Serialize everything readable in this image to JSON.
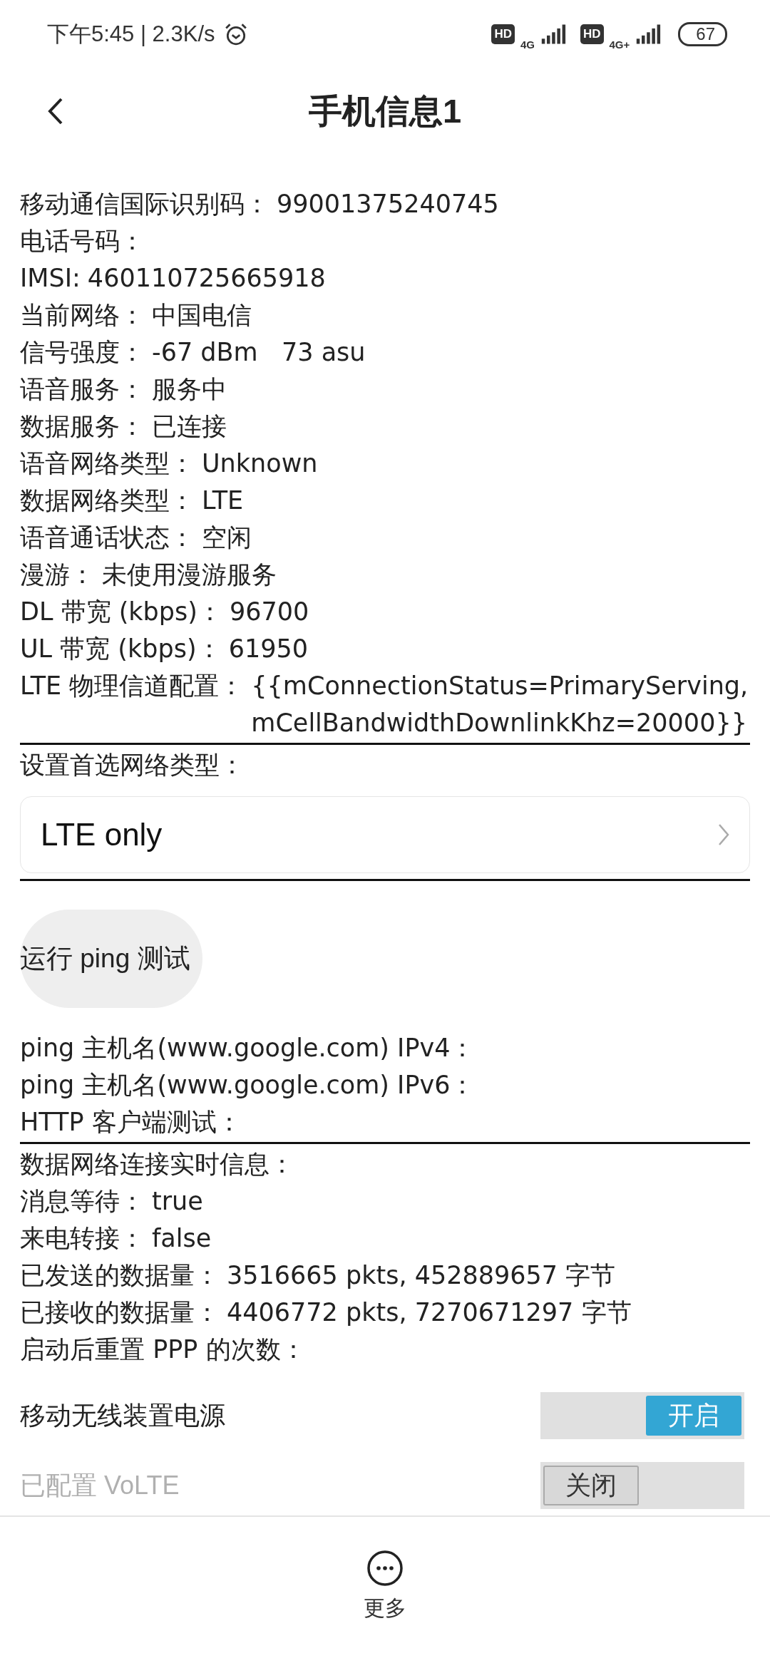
{
  "status_bar": {
    "time": "下午5:45 | 2.3K/s",
    "sim1": {
      "hd": "HD",
      "network": "4G"
    },
    "sim2": {
      "hd": "HD",
      "network": "4G+"
    },
    "battery": "67"
  },
  "header": {
    "title": "手机信息1"
  },
  "info": [
    {
      "label": "移动通信国际识别码：",
      "value": "99001375240745"
    },
    {
      "label": "电话号码："
    },
    {
      "label": "IMSI:",
      "value": "460110725665918"
    },
    {
      "label": "当前网络：",
      "value": "中国电信"
    },
    {
      "label": "信号强度：",
      "value": "-67 dBm   73 asu"
    },
    {
      "label": "语音服务：",
      "value": "服务中"
    },
    {
      "label": "数据服务：",
      "value": "已连接"
    },
    {
      "label": "语音网络类型：",
      "value": "Unknown"
    },
    {
      "label": "数据网络类型：",
      "value": "LTE"
    },
    {
      "label": "语音通话状态：",
      "value": "空闲"
    },
    {
      "label": "漫游：",
      "value": "未使用漫游服务"
    },
    {
      "label": "DL 带宽 (kbps)：",
      "value": "96700"
    },
    {
      "label": "UL 带宽 (kbps)：",
      "value": "61950"
    },
    {
      "label": "LTE 物理信道配置：",
      "value": "{{mConnectionStatus=PrimaryServing,mCellBandwidthDownlinkKhz=20000}}",
      "kind": "block"
    }
  ],
  "preferred_network": {
    "label": "设置首选网络类型：",
    "value": "LTE only"
  },
  "ping_button": "运行 ping 测试",
  "ping": [
    {
      "label": "ping 主机名(www.google.com) IPv4："
    },
    {
      "label": "ping 主机名(www.google.com) IPv6："
    },
    {
      "label": "HTTP 客户端测试："
    }
  ],
  "data_info": [
    {
      "label": "数据网络连接实时信息："
    },
    {
      "label": "消息等待：",
      "value": "true"
    },
    {
      "label": "来电转接：",
      "value": "false"
    },
    {
      "label": "已发送的数据量：",
      "value": "3516665 pkts, 452889657 字节"
    },
    {
      "label": "已接收的数据量：",
      "value": "4406772 pkts, 7270671297 字节"
    },
    {
      "label": "启动后重置 PPP 的次数："
    }
  ],
  "toggles": [
    {
      "label": "移动无线装置电源",
      "state_text": "开启",
      "on": true,
      "disabled": false
    },
    {
      "label": "已配置 VoLTE",
      "state_text": "关闭",
      "on": false,
      "disabled": true
    }
  ],
  "bottom_bar": {
    "label": "更多"
  }
}
